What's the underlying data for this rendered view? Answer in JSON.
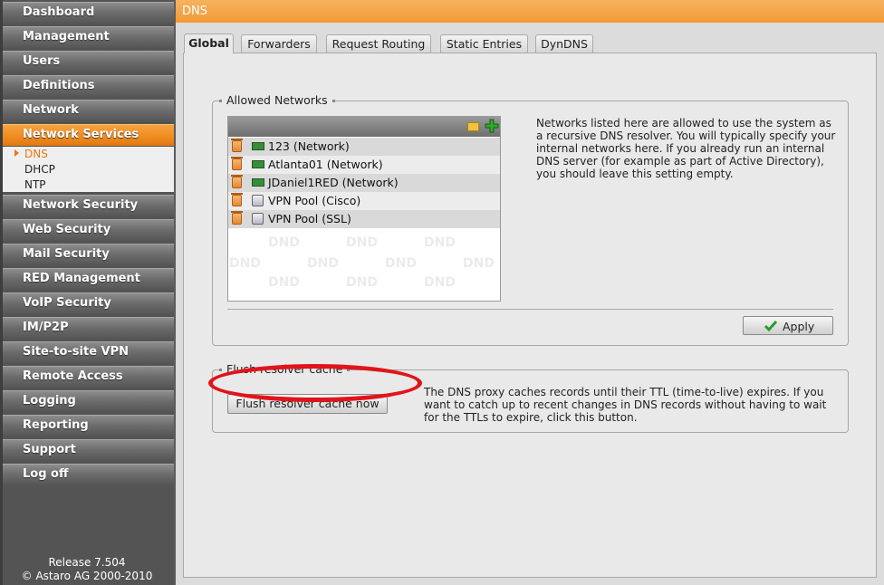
{
  "sidebar": {
    "items": [
      {
        "label": "Dashboard"
      },
      {
        "label": "Management"
      },
      {
        "label": "Users"
      },
      {
        "label": "Definitions"
      },
      {
        "label": "Network"
      },
      {
        "label": "Network Services"
      },
      {
        "label": "Network Security"
      },
      {
        "label": "Web Security"
      },
      {
        "label": "Mail Security"
      },
      {
        "label": "RED Management"
      },
      {
        "label": "VoIP Security"
      },
      {
        "label": "IM/P2P"
      },
      {
        "label": "Site-to-site VPN"
      },
      {
        "label": "Remote Access"
      },
      {
        "label": "Logging"
      },
      {
        "label": "Reporting"
      },
      {
        "label": "Support"
      },
      {
        "label": "Log off"
      }
    ],
    "submenu": [
      "DNS",
      "DHCP",
      "NTP"
    ],
    "release": "Release 7.504",
    "copyright": "© Astaro AG 2000-2010"
  },
  "page": {
    "title": "DNS",
    "tabs": [
      "Global",
      "Forwarders",
      "Request Routing",
      "Static Entries",
      "DynDNS"
    ]
  },
  "allowed": {
    "legend": "Allowed Networks",
    "rows": [
      {
        "label": "123 (Network)",
        "icon": "network-icon"
      },
      {
        "label": "Atlanta01 (Network)",
        "icon": "network-icon"
      },
      {
        "label": "JDaniel1RED (Network)",
        "icon": "network-icon"
      },
      {
        "label": "VPN Pool (Cisco)",
        "icon": "vpn-pool-icon"
      },
      {
        "label": "VPN Pool (SSL)",
        "icon": "vpn-pool-icon"
      }
    ],
    "watermark": "DND",
    "description": "Networks listed here are allowed to use the system as a recursive DNS resolver. You will typically specify your internal networks here. If you already run an internal DNS server (for example as part of Active Directory), you should leave this setting empty.",
    "apply_label": "Apply"
  },
  "flush": {
    "legend": "Flush resolver cache",
    "button_label": "Flush resolver cache now",
    "description": "The DNS proxy caches records until their TTL (time-to-live) expires. If you want to catch up to recent changes in DNS records without having to wait for the TTLs to expire, click this button."
  },
  "colors": {
    "accent": "#f29a35",
    "highlight_ellipse": "#e0141a"
  }
}
